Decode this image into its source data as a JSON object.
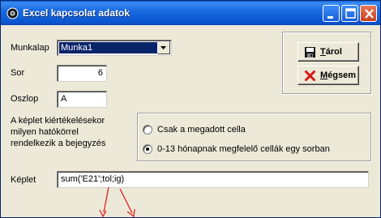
{
  "window": {
    "title": "Excel kapcsolat adatok",
    "titlebar_color": "#0b55cf",
    "controls": [
      "minimize-icon",
      "maximize-icon",
      "close-icon"
    ]
  },
  "form": {
    "munkalap": {
      "label": "Munkalap",
      "value": "Munka1"
    },
    "sor": {
      "label": "Sor",
      "value": "6"
    },
    "oszlop": {
      "label": "Oszlop",
      "value": "A"
    },
    "description": [
      "A képlet kiértékelésekor",
      "milyen hatókörrel",
      "rendelkezik a bejegyzés"
    ],
    "options": [
      {
        "label": "Csak a megadott cella",
        "selected": false
      },
      {
        "label": "0-13 hónapnak megfelelő cellák egy sorban",
        "selected": true
      }
    ],
    "keplet": {
      "label": "Képlet",
      "value": "sum('E21';tol;ig)"
    }
  },
  "buttons": {
    "save": {
      "mnemonic": "T",
      "rest": "árol",
      "icon": "floppy-disk-icon"
    },
    "cancel": {
      "mnemonic": "M",
      "rest": "égsem",
      "icon": "red-x-icon"
    }
  },
  "annotation_color": "#e02020"
}
